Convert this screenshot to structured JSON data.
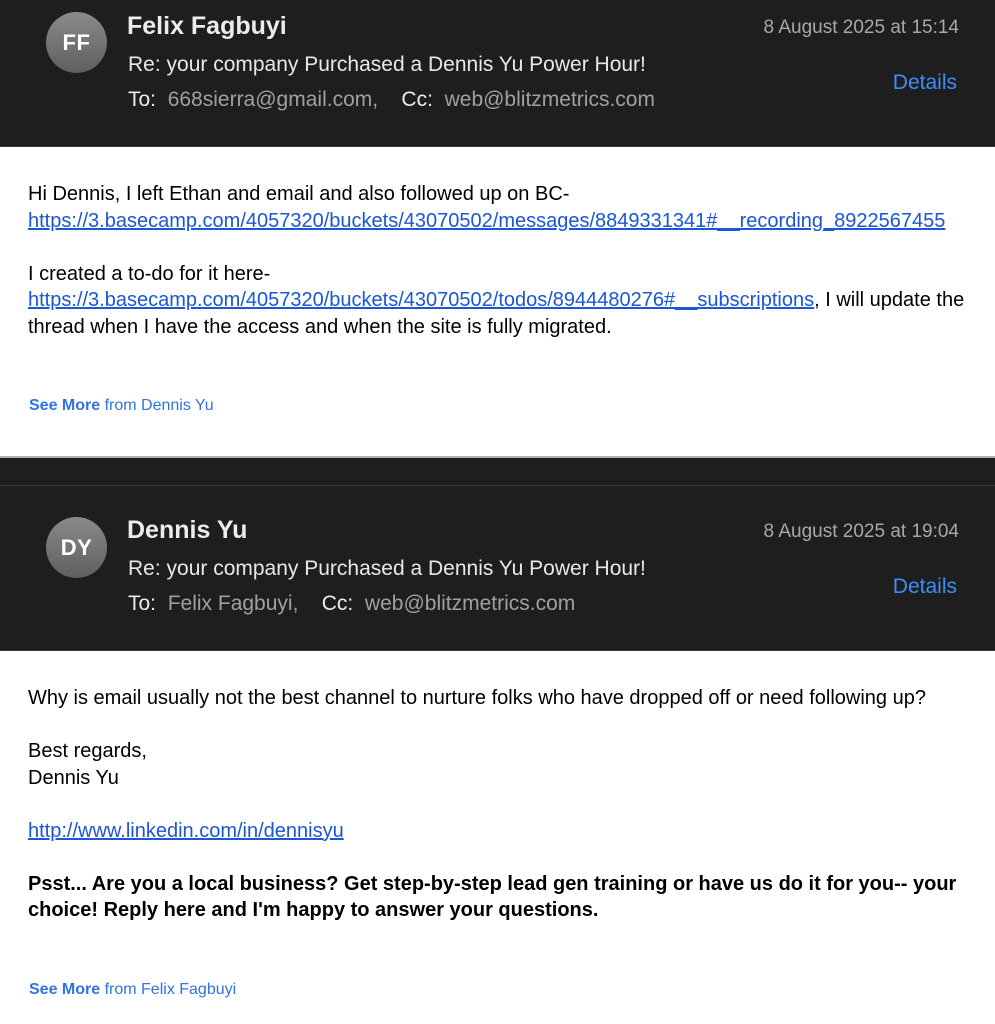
{
  "messages": [
    {
      "avatar_initials": "FF",
      "sender": "Felix Fagbuyi",
      "date": "8 August 2025 at 15:14",
      "subject": "Re: your company Purchased a Dennis Yu Power Hour!",
      "to_label": "To:",
      "to_value": "668sierra@gmail.com,",
      "cc_label": "Cc:",
      "cc_value": "web@blitzmetrics.com",
      "details_label": "Details",
      "body": {
        "para1_text": "Hi Dennis, I left Ethan and email and also followed up on BC-",
        "para1_link": "https://3.basecamp.com/4057320/buckets/43070502/messages/8849331341#__recording_8922567455",
        "para2_text": "I created a to-do for it here-",
        "para2_link": "https://3.basecamp.com/4057320/buckets/43070502/todos/8944480276#__subscriptions",
        "para2_tail": ", I will update the thread when I have the access and when the site is fully migrated."
      },
      "see_more_bold": "See More",
      "see_more_rest": " from Dennis Yu"
    },
    {
      "avatar_initials": "DY",
      "sender": "Dennis Yu",
      "date": "8 August 2025 at 19:04",
      "subject": "Re: your company Purchased a Dennis Yu Power Hour!",
      "to_label": "To:",
      "to_value": "Felix Fagbuyi,",
      "cc_label": "Cc:",
      "cc_value": "web@blitzmetrics.com",
      "details_label": "Details",
      "body": {
        "question": "Why is email usually not the best channel to nurture folks who have dropped off or need following up?",
        "regards": "Best regards,",
        "signature_name": "Dennis Yu",
        "linkedin": "http://www.linkedin.com/in/dennisyu",
        "promo": "Psst... Are you a local business? Get step-by-step lead gen training or have us do it for you-- your choice!  Reply here and I'm happy to answer your questions."
      },
      "see_more_bold": "See More",
      "see_more_rest": " from Felix Fagbuyi"
    }
  ],
  "colors": {
    "header_bg": "#1e1e1e",
    "link": "#1a56d6",
    "details": "#3d8df5",
    "see_more": "#2f74e0"
  }
}
